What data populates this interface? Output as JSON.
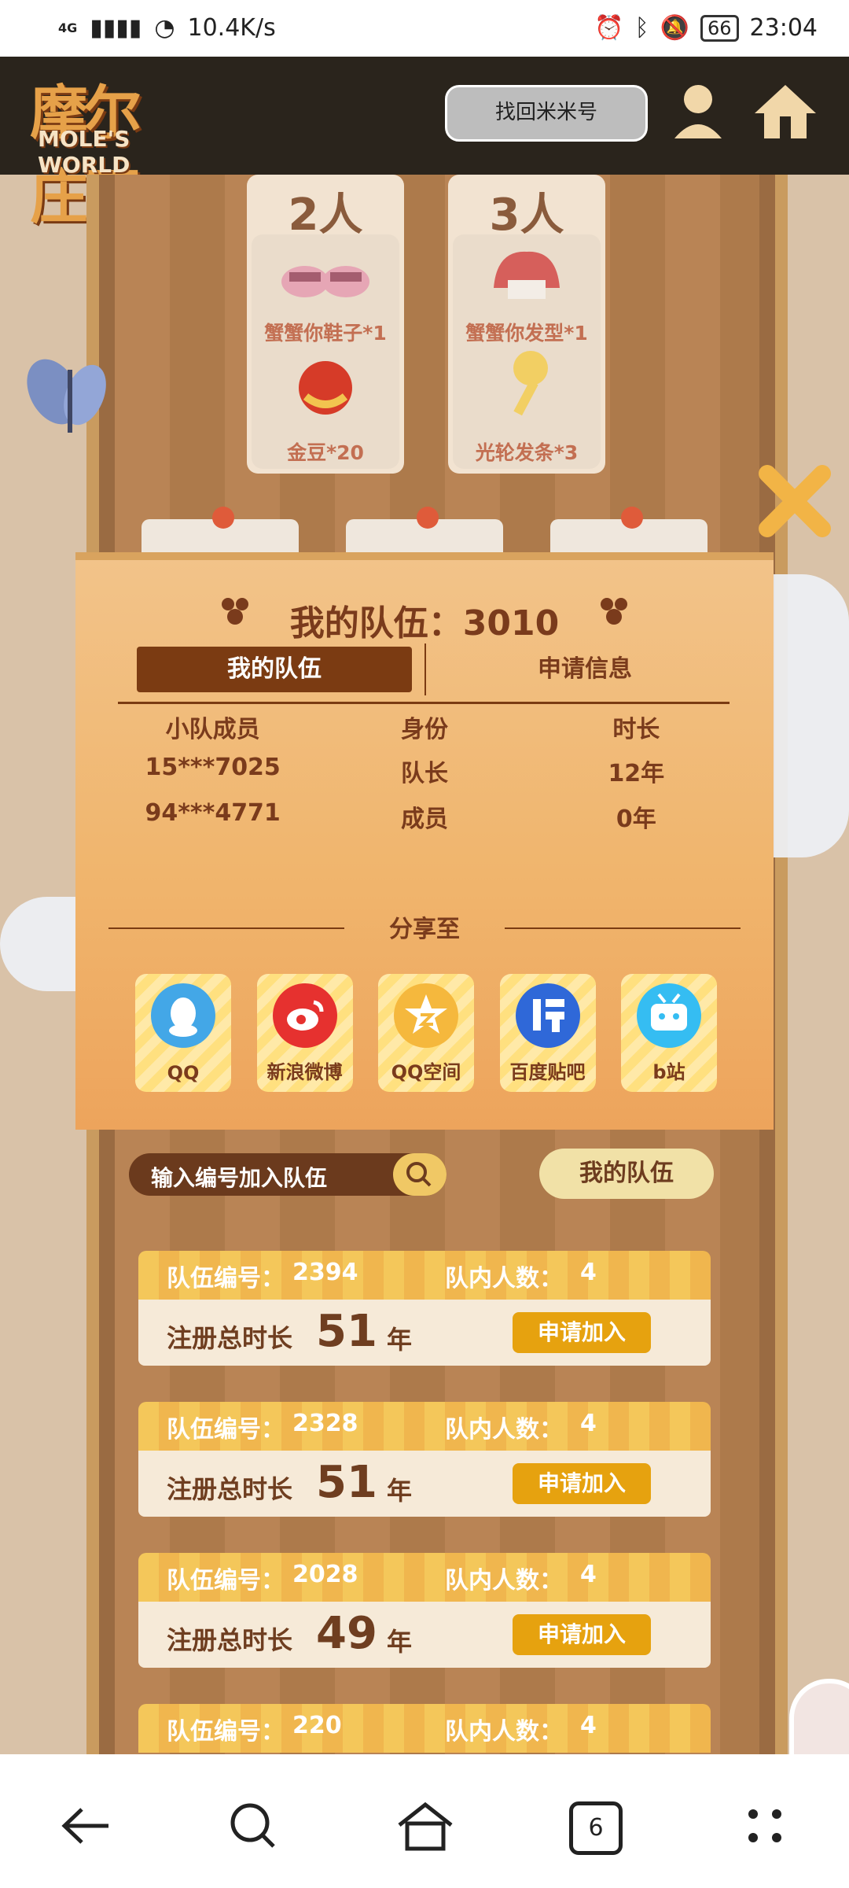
{
  "status_bar": {
    "network_badge": "4G",
    "speed": "10.4K/s",
    "battery": "66",
    "time": "23:04"
  },
  "header": {
    "logo_main": "摩尔庄园",
    "logo_sub": "MOLE'S WORLD",
    "find_button": "找回米米号",
    "user_icon": "user-icon",
    "home_icon": "home-icon"
  },
  "rewards": [
    {
      "count": "2人",
      "items": [
        "蟹蟹你鞋子*1",
        "金豆*20"
      ]
    },
    {
      "count": "3人",
      "items": [
        "蟹蟹你发型*1",
        "光轮发条*3"
      ]
    }
  ],
  "modal": {
    "title": "我的队伍：3010",
    "tabs": [
      "我的队伍",
      "申请信息"
    ],
    "table_headers": [
      "小队成员",
      "身份",
      "时长"
    ],
    "rows": [
      [
        "15***7025",
        "队长",
        "12年"
      ],
      [
        "94***4771",
        "成员",
        "0年"
      ]
    ],
    "share_title": "分享至",
    "share_targets": [
      "QQ",
      "新浪微博",
      "QQ空间",
      "百度贴吧",
      "b站"
    ]
  },
  "join": {
    "placeholder": "输入编号加入队伍",
    "my_team": "我的队伍"
  },
  "team_cards": [
    {
      "id_label": "队伍编号：",
      "id": "2394",
      "members_label": "队内人数：",
      "members": "4",
      "total_label": "注册总时长",
      "total": "51",
      "unit": "年",
      "button": "申请加入"
    },
    {
      "id_label": "队伍编号：",
      "id": "2328",
      "members_label": "队内人数：",
      "members": "4",
      "total_label": "注册总时长",
      "total": "51",
      "unit": "年",
      "button": "申请加入"
    },
    {
      "id_label": "队伍编号：",
      "id": "2028",
      "members_label": "队内人数：",
      "members": "4",
      "total_label": "注册总时长",
      "total": "49",
      "unit": "年",
      "button": "申请加入"
    },
    {
      "id_label": "队伍编号：",
      "id": "220",
      "members_label": "队内人数：",
      "members": "4"
    }
  ],
  "bottom_nav": {
    "tab_count": "6",
    "icons": [
      "back-icon",
      "search-icon",
      "home-icon",
      "tabs-icon",
      "menu-icon"
    ]
  }
}
